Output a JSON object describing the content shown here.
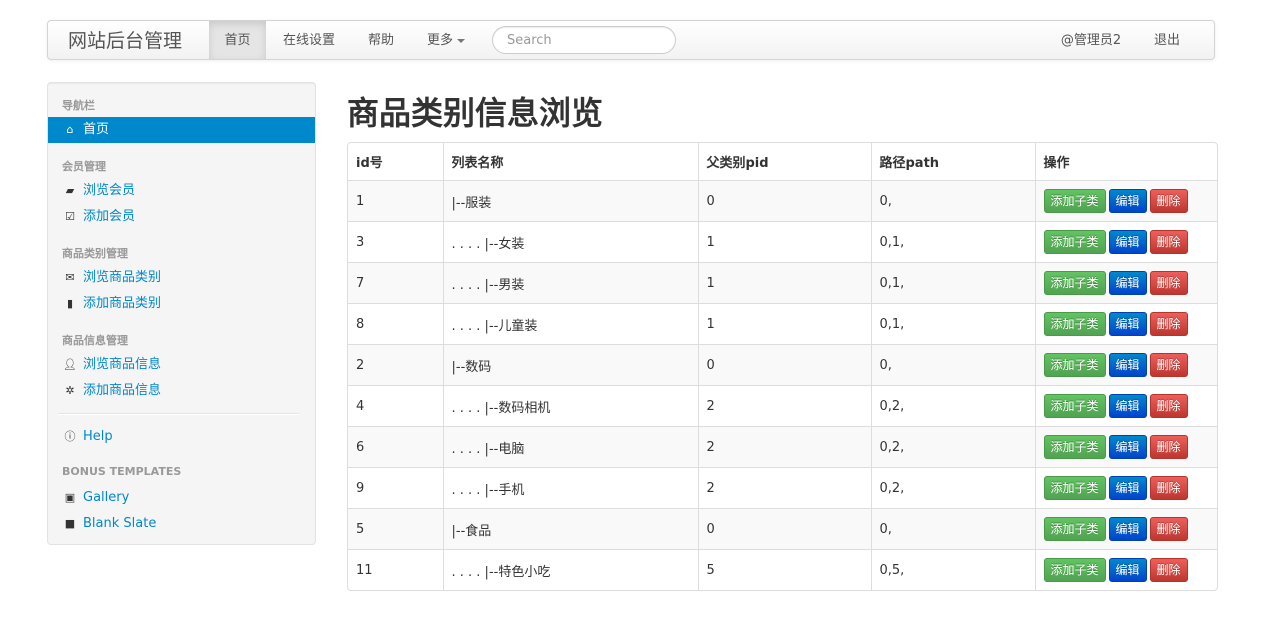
{
  "navbar": {
    "brand": "网站后台管理",
    "items": [
      {
        "label": "首页"
      },
      {
        "label": "在线设置"
      },
      {
        "label": "帮助"
      },
      {
        "label": "更多"
      }
    ],
    "search_placeholder": "Search",
    "user": "@管理员2",
    "logout": "退出"
  },
  "sidebar": {
    "headers": [
      "导航栏",
      "会员管理",
      "商品类别管理",
      "商品信息管理",
      "BONUS TEMPLATES"
    ],
    "items": [
      {
        "label": "首页",
        "icon": "home-icon"
      },
      {
        "label": "浏览会员",
        "icon": "folder-open-icon"
      },
      {
        "label": "添加会员",
        "icon": "check-icon"
      },
      {
        "label": "浏览商品类别",
        "icon": "envelope-icon"
      },
      {
        "label": "添加商品类别",
        "icon": "file-icon"
      },
      {
        "label": "浏览商品信息",
        "icon": "user-icon"
      },
      {
        "label": "添加商品信息",
        "icon": "cog-icon"
      },
      {
        "label": "Help",
        "icon": "info-icon"
      },
      {
        "label": "Gallery",
        "icon": "picture-icon"
      },
      {
        "label": "Blank Slate",
        "icon": "stop-icon"
      }
    ]
  },
  "main": {
    "title": "商品类别信息浏览",
    "columns": [
      "id号",
      "列表名称",
      "父类别pid",
      "路径path",
      "操作"
    ],
    "rows": [
      {
        "id": "1",
        "name": "|--服装",
        "pid": "0",
        "path": "0,"
      },
      {
        "id": "3",
        "name": ". . . . |--女装",
        "pid": "1",
        "path": "0,1,"
      },
      {
        "id": "7",
        "name": ". . . . |--男装",
        "pid": "1",
        "path": "0,1,"
      },
      {
        "id": "8",
        "name": ". . . . |--儿童装",
        "pid": "1",
        "path": "0,1,"
      },
      {
        "id": "2",
        "name": "|--数码",
        "pid": "0",
        "path": "0,"
      },
      {
        "id": "4",
        "name": ". . . . |--数码相机",
        "pid": "2",
        "path": "0,2,"
      },
      {
        "id": "6",
        "name": ". . . . |--电脑",
        "pid": "2",
        "path": "0,2,"
      },
      {
        "id": "9",
        "name": ". . . . |--手机",
        "pid": "2",
        "path": "0,2,"
      },
      {
        "id": "5",
        "name": "|--食品",
        "pid": "0",
        "path": "0,"
      },
      {
        "id": "11",
        "name": ". . . . |--特色小吃",
        "pid": "5",
        "path": "0,5,"
      }
    ],
    "actions": {
      "add_child": "添加子类",
      "edit": "编辑",
      "delete": "删除"
    }
  },
  "colors": {
    "accent": "#0088cc",
    "success": "#51a351",
    "primary": "#0044cc",
    "danger": "#bd362f"
  }
}
